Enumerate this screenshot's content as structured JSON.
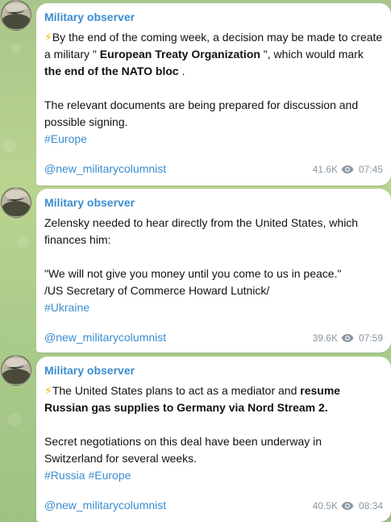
{
  "messages": [
    {
      "sender": "Military observer",
      "lines": {
        "p1_icon": "⚡",
        "p1_a": "By the end of the coming week, a decision may be made to create a military \" ",
        "p1_b": "European Treaty Organization",
        "p1_c": " \", which would mark ",
        "p1_d": "the end of the NATO bloc",
        "p1_e": " .",
        "p2": "The relevant documents are being prepared for discussion and possible signing.",
        "tags": "#Europe"
      },
      "channel": "@new_militarycolumnist",
      "views": "41.6K",
      "time": "07:45"
    },
    {
      "sender": "Military observer",
      "lines": {
        "p1": "Zelensky needed to hear directly from the United States, which finances him:",
        "p2": "\"We will not give you money until you come to us in peace.\"",
        "p3": "/US Secretary of Commerce Howard Lutnick/",
        "tags": "#Ukraine"
      },
      "channel": "@new_militarycolumnist",
      "views": "39.6K",
      "time": "07:59"
    },
    {
      "sender": "Military observer",
      "lines": {
        "p1_icon": "⚡",
        "p1_a": "The United States plans to act as a mediator and ",
        "p1_b": "resume Russian gas supplies to Germany via Nord Stream 2.",
        "p2": "Secret negotiations on this deal have been underway in Switzerland for several weeks.",
        "tags": "#Russia #Europe"
      },
      "channel": "@new_militarycolumnist",
      "views": "40.5K",
      "time": "08:34"
    }
  ],
  "colors": {
    "accent": "#3a8ccf",
    "meta": "#8a97a3",
    "bolt": "#f2b705"
  },
  "icons": {
    "views": "eye-icon",
    "bolt": "lightning-emoji"
  }
}
